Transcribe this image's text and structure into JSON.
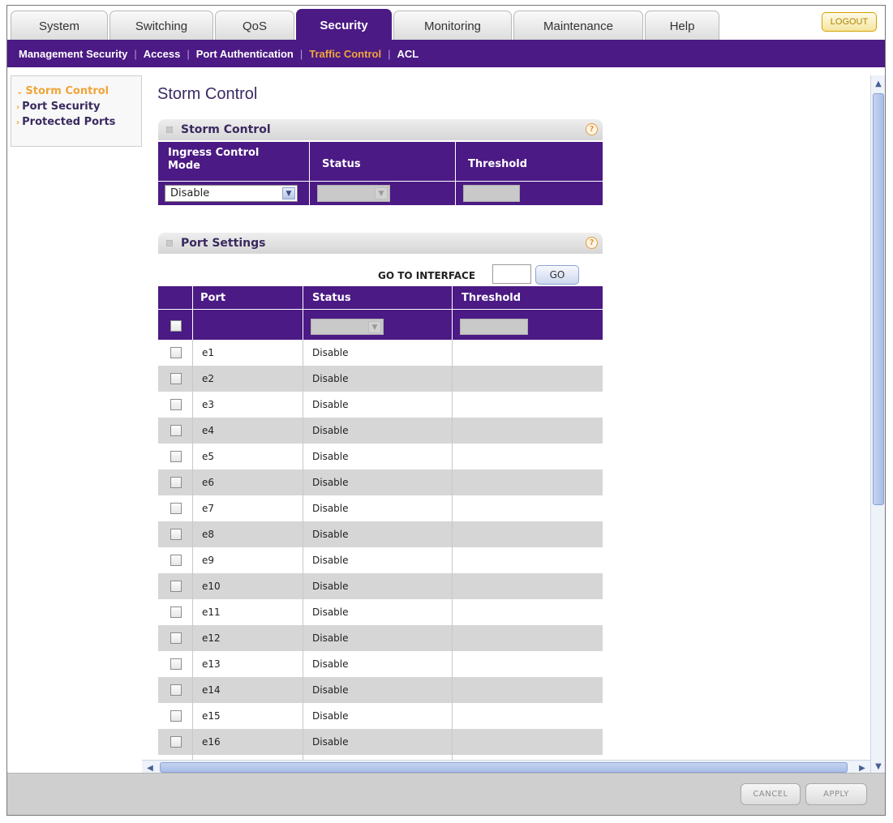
{
  "tabs": [
    {
      "label": "System",
      "active": false
    },
    {
      "label": "Switching",
      "active": false
    },
    {
      "label": "QoS",
      "active": false
    },
    {
      "label": "Security",
      "active": true
    },
    {
      "label": "Monitoring",
      "active": false
    },
    {
      "label": "Maintenance",
      "active": false
    },
    {
      "label": "Help",
      "active": false
    }
  ],
  "logout_label": "LOGOUT",
  "subnav": [
    {
      "label": "Management Security",
      "active": false
    },
    {
      "label": "Access",
      "active": false
    },
    {
      "label": "Port Authentication",
      "active": false
    },
    {
      "label": "Traffic Control",
      "active": true
    },
    {
      "label": "ACL",
      "active": false
    }
  ],
  "sidebar": {
    "items": [
      {
        "label": "Storm Control",
        "active": true
      },
      {
        "label": "Port Security",
        "active": false
      },
      {
        "label": "Protected Ports",
        "active": false
      }
    ]
  },
  "page_title": "Storm Control",
  "storm_panel": {
    "title": "Storm Control",
    "col_mode": "Ingress Control Mode",
    "col_status": "Status",
    "col_threshold": "Threshold",
    "mode_value": "Disable"
  },
  "port_panel": {
    "title": "Port Settings",
    "goto_label": "GO TO INTERFACE",
    "go_label": "GO",
    "col_port": "Port",
    "col_status": "Status",
    "col_threshold": "Threshold",
    "rows": [
      {
        "port": "e1",
        "status": "Disable",
        "threshold": ""
      },
      {
        "port": "e2",
        "status": "Disable",
        "threshold": ""
      },
      {
        "port": "e3",
        "status": "Disable",
        "threshold": ""
      },
      {
        "port": "e4",
        "status": "Disable",
        "threshold": ""
      },
      {
        "port": "e5",
        "status": "Disable",
        "threshold": ""
      },
      {
        "port": "e6",
        "status": "Disable",
        "threshold": ""
      },
      {
        "port": "e7",
        "status": "Disable",
        "threshold": ""
      },
      {
        "port": "e8",
        "status": "Disable",
        "threshold": ""
      },
      {
        "port": "e9",
        "status": "Disable",
        "threshold": ""
      },
      {
        "port": "e10",
        "status": "Disable",
        "threshold": ""
      },
      {
        "port": "e11",
        "status": "Disable",
        "threshold": ""
      },
      {
        "port": "e12",
        "status": "Disable",
        "threshold": ""
      },
      {
        "port": "e13",
        "status": "Disable",
        "threshold": ""
      },
      {
        "port": "e14",
        "status": "Disable",
        "threshold": ""
      },
      {
        "port": "e15",
        "status": "Disable",
        "threshold": ""
      },
      {
        "port": "e16",
        "status": "Disable",
        "threshold": ""
      }
    ]
  },
  "footer": {
    "cancel_label": "CANCEL",
    "apply_label": "APPLY"
  },
  "colors": {
    "brand_purple": "#4b1a84",
    "accent_orange": "#f0a53a"
  }
}
